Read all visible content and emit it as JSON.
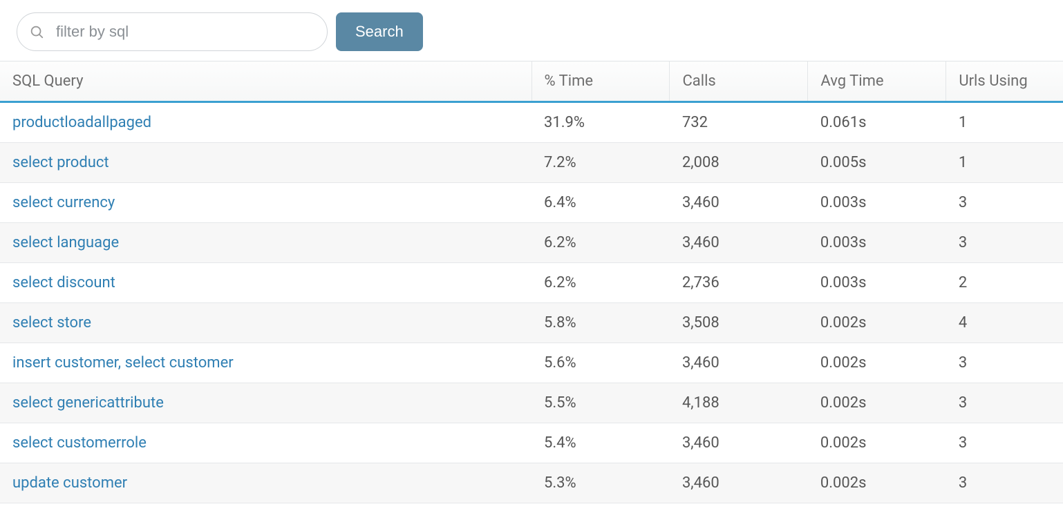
{
  "search": {
    "placeholder": "filter by sql",
    "button_label": "Search"
  },
  "table": {
    "headers": {
      "query": "SQL Query",
      "pct_time": "% Time",
      "calls": "Calls",
      "avg_time": "Avg Time",
      "urls_using": "Urls Using"
    },
    "rows": [
      {
        "query": "productloadallpaged",
        "pct_time": "31.9%",
        "calls": "732",
        "avg_time": "0.061s",
        "urls_using": "1"
      },
      {
        "query": "select product",
        "pct_time": "7.2%",
        "calls": "2,008",
        "avg_time": "0.005s",
        "urls_using": "1"
      },
      {
        "query": "select currency",
        "pct_time": "6.4%",
        "calls": "3,460",
        "avg_time": "0.003s",
        "urls_using": "3"
      },
      {
        "query": "select language",
        "pct_time": "6.2%",
        "calls": "3,460",
        "avg_time": "0.003s",
        "urls_using": "3"
      },
      {
        "query": "select discount",
        "pct_time": "6.2%",
        "calls": "2,736",
        "avg_time": "0.003s",
        "urls_using": "2"
      },
      {
        "query": "select store",
        "pct_time": "5.8%",
        "calls": "3,508",
        "avg_time": "0.002s",
        "urls_using": "4"
      },
      {
        "query": "insert customer, select customer",
        "pct_time": "5.6%",
        "calls": "3,460",
        "avg_time": "0.002s",
        "urls_using": "3"
      },
      {
        "query": "select genericattribute",
        "pct_time": "5.5%",
        "calls": "4,188",
        "avg_time": "0.002s",
        "urls_using": "3"
      },
      {
        "query": "select customerrole",
        "pct_time": "5.4%",
        "calls": "3,460",
        "avg_time": "0.002s",
        "urls_using": "3"
      },
      {
        "query": "update customer",
        "pct_time": "5.3%",
        "calls": "3,460",
        "avg_time": "0.002s",
        "urls_using": "3"
      }
    ]
  }
}
